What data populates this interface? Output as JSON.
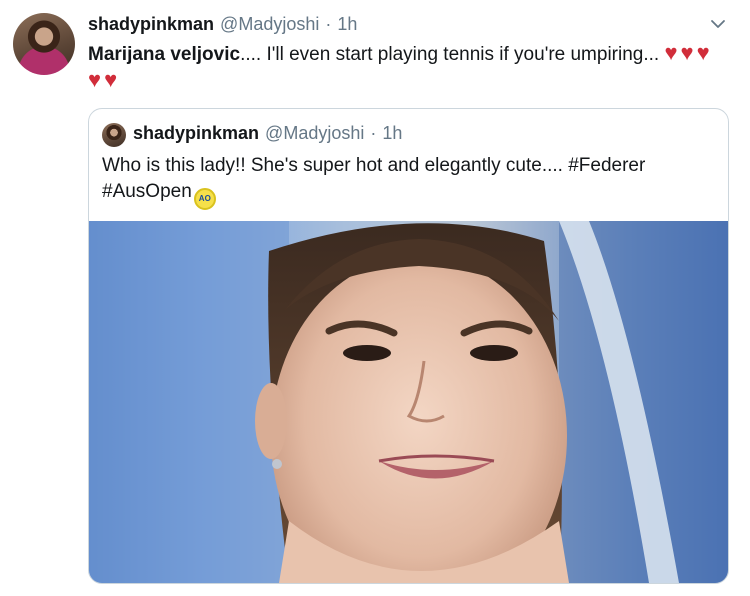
{
  "tweet": {
    "display_name": "shadypinkman",
    "handle": "@Madyjoshi",
    "separator": "·",
    "time": "1h",
    "text_name": "Marijana veljovic",
    "text_rest": ".... I'll even start playing tennis if you're umpiring...",
    "hearts_line1": "♥♥♥",
    "hearts_line2": "♥♥",
    "menu_icon": "chevron-down-icon"
  },
  "quoted_tweet": {
    "display_name": "shadypinkman",
    "handle": "@Madyjoshi",
    "separator": "·",
    "time": "1h",
    "text": "Who is this lady!! She's super hot and elegantly cute.... ",
    "hashtag1": "#Federer",
    "hashtag2": "#AusOpen",
    "emoji_label": "AO",
    "image_alt": "photo of a smiling woman umpire"
  },
  "colors": {
    "heart": "#d12d3a",
    "secondary_text": "#657786",
    "border": "#ccd6dd"
  }
}
